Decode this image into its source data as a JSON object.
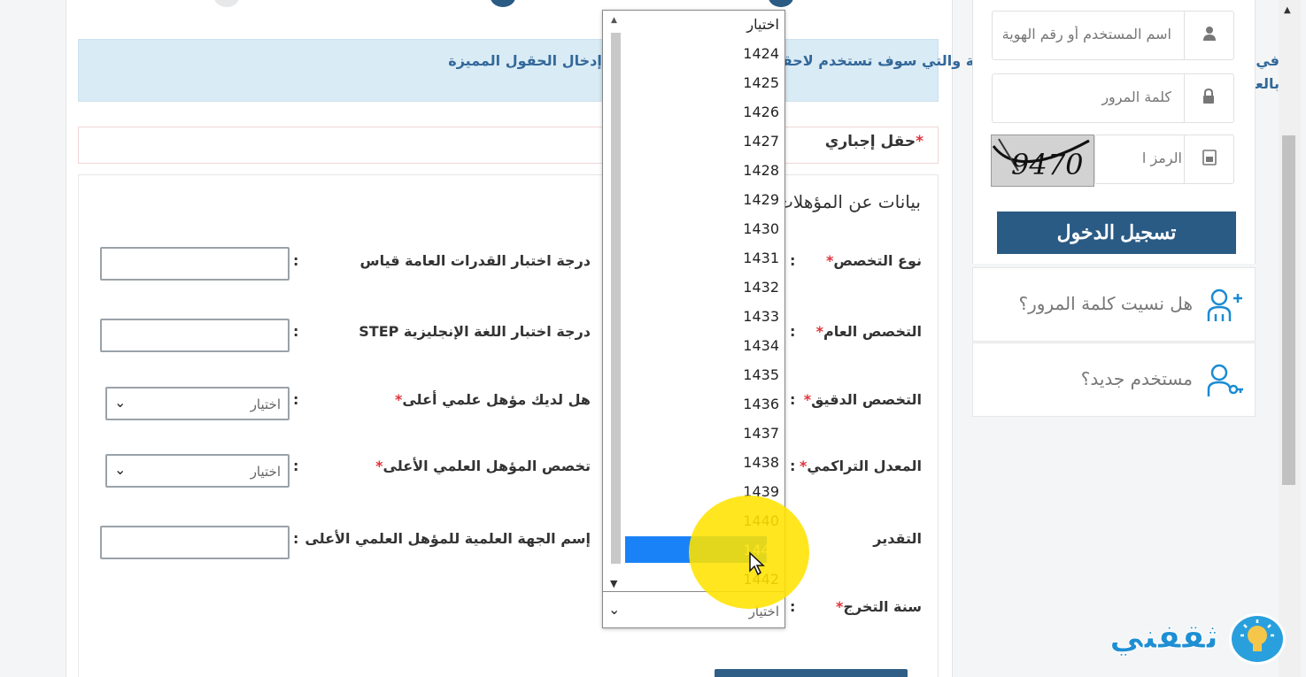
{
  "form": {
    "info_text": "في هذه الخطوة، ينبغي تعبئة مؤهلاتك العلمية والتي سوف تستخدم لاحقا للاتصال بك. ينبغي عليك إدخال الحقول المميزة بالعلامة",
    "required_label": "حقل إجباري",
    "section_title": "بيانات عن المؤهلات",
    "fields_right": [
      {
        "label": "نوع التخصص"
      },
      {
        "label": "التخصص العام"
      },
      {
        "label": "التخصص الدقيق"
      },
      {
        "label": "المعدل التراكمي"
      },
      {
        "label": "التقدير"
      },
      {
        "label": "سنة التخرج"
      }
    ],
    "fields_left": [
      {
        "label": "درجة اختبار القدرات العامة قياس"
      },
      {
        "label": "درجة اختبار اللغة الإنجليزية STEP"
      },
      {
        "label": "هل لديك مؤهل علمي أعلى",
        "value": "اختيار"
      },
      {
        "label": "تخصص المؤهل العلمي الأعلى",
        "value": "اختيار"
      },
      {
        "label": "إسم الجهة العلمية للمؤهل العلمي الأعلى"
      }
    ],
    "required_mark": "*",
    "colon": ":"
  },
  "dropdown": {
    "options": [
      "اختيار",
      "1424",
      "1425",
      "1426",
      "1427",
      "1428",
      "1429",
      "1430",
      "1431",
      "1432",
      "1433",
      "1434",
      "1435",
      "1436",
      "1437",
      "1438",
      "1439",
      "1440",
      "1441",
      "1442"
    ],
    "highlighted": "1441",
    "current_value": "اختيار"
  },
  "sidebar": {
    "username_placeholder": "اسم المستخدم أو رقم الهوية",
    "password_placeholder": "كلمة المرور",
    "captcha_placeholder": "الرمز المرئي",
    "captcha_code": "9470",
    "login_label": "تسجيل الدخول",
    "forgot_password": "هل نسيت كلمة المرور؟",
    "new_user": "مستخدم جديد؟"
  },
  "watermark": {
    "text": "ثقفني"
  },
  "colors": {
    "primary": "#2a5b84",
    "info_bg": "#d9ebf5",
    "info_text": "#33689a",
    "required": "#e0333a",
    "highlight": "#1a82f7",
    "icon_blue": "#1a8bd3"
  },
  "icons": [
    "user-icon",
    "lock-icon",
    "captcha-icon",
    "forgot-password-icon",
    "new-user-icon",
    "bulb-icon"
  ]
}
